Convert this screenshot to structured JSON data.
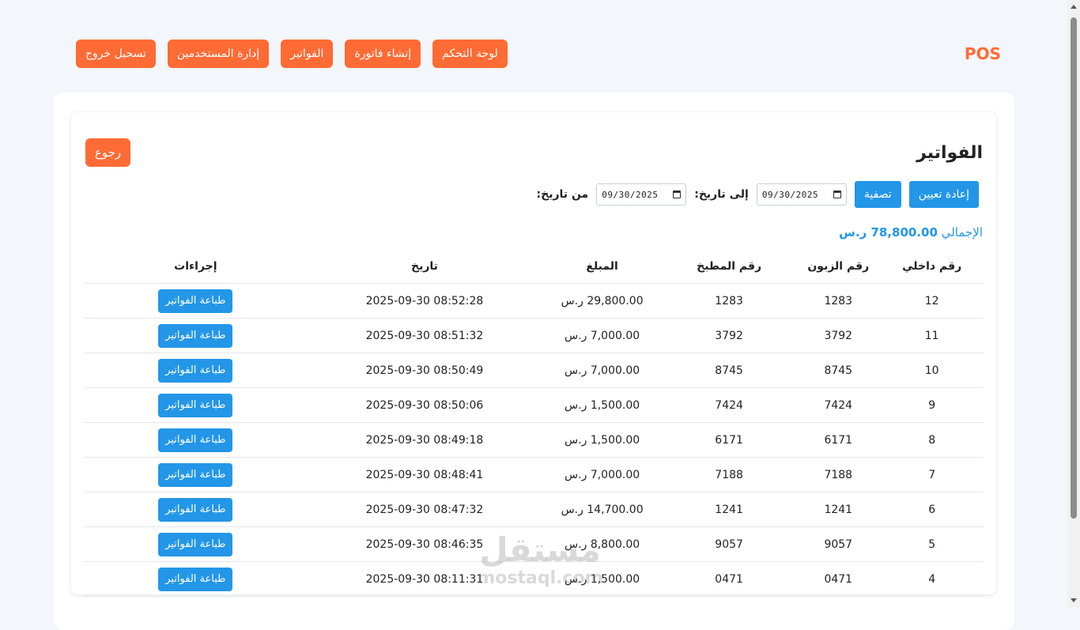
{
  "header": {
    "brand": "POS",
    "nav": [
      {
        "label": "لوحة التحكم",
        "name": "nav-dashboard"
      },
      {
        "label": "إنشاء فاتورة",
        "name": "nav-create-invoice"
      },
      {
        "label": "الفواتير",
        "name": "nav-invoices"
      },
      {
        "label": "إدارة المستخدمين",
        "name": "nav-user-management"
      },
      {
        "label": "تسجيل خروج",
        "name": "nav-logout"
      }
    ]
  },
  "page": {
    "title": "الفواتير",
    "back_label": "رجوع"
  },
  "filters": {
    "from_label": "من تاريخ:",
    "from_value": "09/30/2025",
    "to_label": "إلى تاريخ:",
    "to_value": "09/30/2025",
    "filter_label": "تصفية",
    "reset_label": "إعادة تعيين"
  },
  "summary": {
    "total_label": "الإجمالي",
    "total_value": "78,800.00 ر.س"
  },
  "table": {
    "columns": [
      "رقم داخلي",
      "رقم الزبون",
      "رقم المطبخ",
      "المبلغ",
      "تاريخ",
      "إجراءات"
    ],
    "action_label": "طباعة الفواتير",
    "rows": [
      {
        "id": "12",
        "customer": "1283",
        "kitchen": "1283",
        "amount": "29,800.00 ر.س",
        "date": "2025-09-30 08:52:28"
      },
      {
        "id": "11",
        "customer": "3792",
        "kitchen": "3792",
        "amount": "7,000.00 ر.س",
        "date": "2025-09-30 08:51:32"
      },
      {
        "id": "10",
        "customer": "8745",
        "kitchen": "8745",
        "amount": "7,000.00 ر.س",
        "date": "2025-09-30 08:50:49"
      },
      {
        "id": "9",
        "customer": "7424",
        "kitchen": "7424",
        "amount": "1,500.00 ر.س",
        "date": "2025-09-30 08:50:06"
      },
      {
        "id": "8",
        "customer": "6171",
        "kitchen": "6171",
        "amount": "1,500.00 ر.س",
        "date": "2025-09-30 08:49:18"
      },
      {
        "id": "7",
        "customer": "7188",
        "kitchen": "7188",
        "amount": "7,000.00 ر.س",
        "date": "2025-09-30 08:48:41"
      },
      {
        "id": "6",
        "customer": "1241",
        "kitchen": "1241",
        "amount": "14,700.00 ر.س",
        "date": "2025-09-30 08:47:32"
      },
      {
        "id": "5",
        "customer": "9057",
        "kitchen": "9057",
        "amount": "8,800.00 ر.س",
        "date": "2025-09-30 08:46:35"
      },
      {
        "id": "4",
        "customer": "0471",
        "kitchen": "0471",
        "amount": "1,500.00 ر.س",
        "date": "2025-09-30 08:11:31"
      }
    ]
  },
  "watermark": {
    "arabic": "مستقل",
    "latin": "mostaql.com"
  }
}
